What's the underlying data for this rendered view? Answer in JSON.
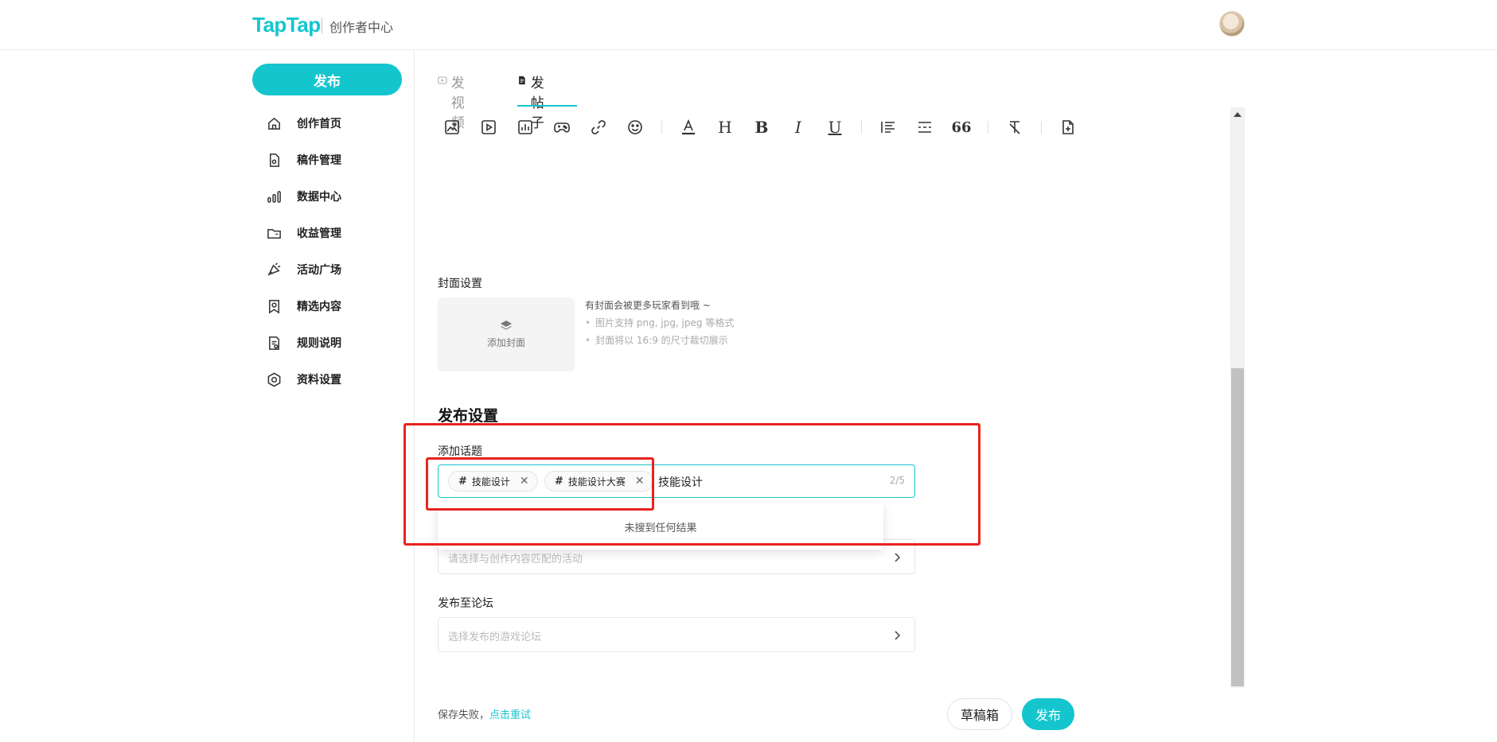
{
  "header": {
    "logo": "TapTap",
    "subtitle": "创作者中心"
  },
  "sidebar": {
    "publish_label": "发布",
    "items": [
      {
        "label": "创作首页",
        "icon": "home-icon"
      },
      {
        "label": "稿件管理",
        "icon": "document-icon"
      },
      {
        "label": "数据中心",
        "icon": "bar-chart-icon"
      },
      {
        "label": "收益管理",
        "icon": "folder-icon"
      },
      {
        "label": "活动广场",
        "icon": "megaphone-icon"
      },
      {
        "label": "精选内容",
        "icon": "badge-icon"
      },
      {
        "label": "规则说明",
        "icon": "rules-icon"
      },
      {
        "label": "资料设置",
        "icon": "settings-icon"
      }
    ]
  },
  "tabs": [
    {
      "label": "发视频",
      "active": false
    },
    {
      "label": "发帖子",
      "active": true
    }
  ],
  "toolbar": {
    "heading_glyph": "H",
    "bold_glyph": "B",
    "italic_glyph": "I",
    "underline_glyph": "U",
    "quote_glyph": "66"
  },
  "cover": {
    "label": "封面设置",
    "button_label": "添加封面",
    "tip": "有封面会被更多玩家看到哦 ~",
    "bullets": [
      "图片支持 png, jpg, jpeg 等格式",
      "封面将以 16:9 的尺寸裁切展示"
    ]
  },
  "publish_settings": {
    "title": "发布设置",
    "topic_label": "添加话题",
    "tags": [
      "技能设计",
      "技能设计大赛"
    ],
    "typed_value": "技能设计",
    "count": "2/5",
    "no_results": "未搜到任何结果",
    "activity_placeholder": "请选择与创作内容匹配的活动",
    "forum_label": "发布至论坛",
    "forum_placeholder": "选择发布的游戏论坛"
  },
  "footer": {
    "save_status": "保存失败，",
    "retry_label": "点击重试",
    "draft_label": "草稿箱",
    "publish_label": "发布"
  },
  "colors": {
    "accent": "#15c5ce",
    "annotation": "#e8231e"
  }
}
